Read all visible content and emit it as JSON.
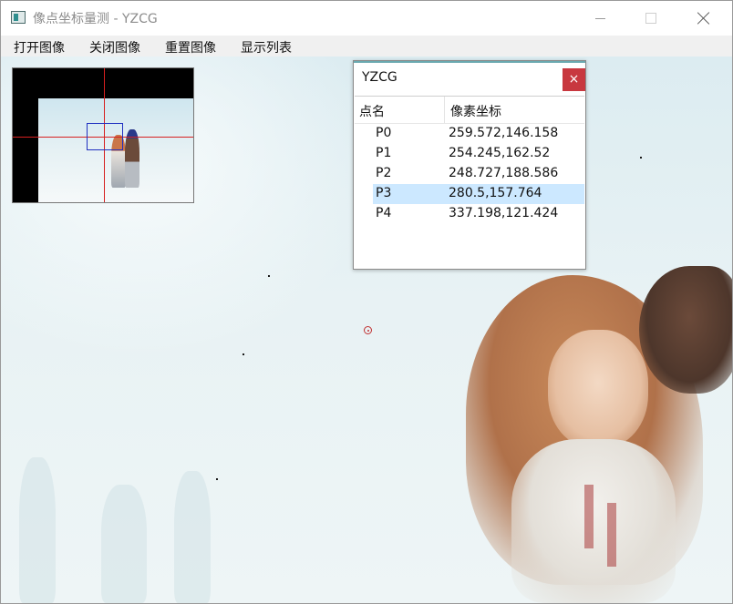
{
  "window": {
    "title": "像点坐标量测 - YZCG",
    "icon": "app-window-icon"
  },
  "menu": {
    "items": [
      "打开图像",
      "关闭图像",
      "重置图像",
      "显示列表"
    ]
  },
  "dialog": {
    "title": "YZCG",
    "close_label": "×",
    "columns": [
      "点名",
      "像素坐标"
    ],
    "rows": [
      {
        "name": "P0",
        "coord": "259.572,146.158"
      },
      {
        "name": "P1",
        "coord": "254.245,162.52"
      },
      {
        "name": "P2",
        "coord": "248.727,188.586"
      },
      {
        "name": "P3",
        "coord": "280.5,157.764"
      },
      {
        "name": "P4",
        "coord": "337.198,121.424"
      }
    ],
    "selected_row": "P3"
  },
  "colors": {
    "accent_close": "#c8383f",
    "selection": "#cce8ff",
    "crosshair": "#d62020",
    "viewport_rect": "#2030c0",
    "marker": "#c03030"
  }
}
